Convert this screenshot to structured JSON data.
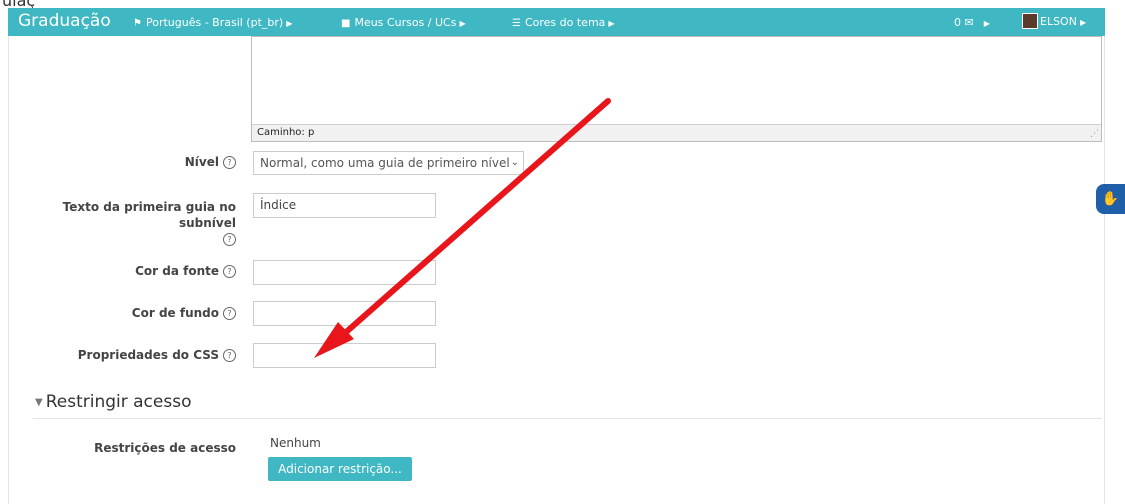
{
  "navbar": {
    "brand": "Graduação",
    "language": "Português - Brasil (pt_br)",
    "courses": "Meus Cursos / UCs",
    "theme": "Cores do tema",
    "messages_count": "0",
    "user": "ELSON"
  },
  "editor": {
    "path_label": "Caminho: p"
  },
  "form": {
    "nivel_label": "Nível",
    "nivel_value": "Normal, como uma guia de primeiro nível",
    "texto_label_line1": "Texto da primeira guia no",
    "texto_label_line2": "subnível",
    "texto_value": "Índice",
    "cor_fonte_label": "Cor da fonte",
    "cor_fundo_label": "Cor de fundo",
    "css_label": "Propriedades do CSS"
  },
  "restrict": {
    "section_title": "Restringir acesso",
    "label": "Restrições de acesso",
    "none_text": "Nenhum",
    "add_button": "Adicionar restrição..."
  },
  "colors": {
    "accent": "#3fb8c4",
    "arrow": "#e8161b",
    "a11y": "#1f5fa8"
  },
  "icons": [
    "flag-icon",
    "briefcase-icon",
    "grid-icon",
    "envelope-icon",
    "help-icon",
    "hand-icon"
  ]
}
